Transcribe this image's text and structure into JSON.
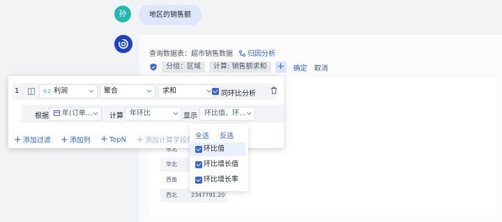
{
  "user_avatar": "孙",
  "user_message": "地区的销售额",
  "query": {
    "dataset_label": "查询数据表：超市销售数据",
    "attribution_link": "归因分析"
  },
  "chips": {
    "group": "分组：区域",
    "calc": "计算: 销售额求和",
    "confirm": "确定",
    "cancel": "取消"
  },
  "table_rows": [
    {
      "name": "东北",
      "value": ""
    },
    {
      "name": "华北",
      "value": ""
    },
    {
      "name": "西南",
      "value": ""
    },
    {
      "name": "西北",
      "value": "2347791.20"
    }
  ],
  "metric": {
    "index": "1",
    "field_tag": "0.2",
    "field": "利润",
    "mode": "聚合",
    "agg": "求和",
    "yoy_label": "同环比分析"
  },
  "basis": {
    "basis_label": "根据",
    "basis_value": "年(订单...",
    "calc_label": "计算",
    "calc_value": "年环比",
    "show_label": "显示",
    "show_value": "环比值、环..."
  },
  "actions": {
    "add_filter": "添加过滤",
    "add_column": "添加列",
    "topn": "TopN",
    "add_calc_field": "添加计算字段筛"
  },
  "dropdown": {
    "select_all": "全选",
    "invert": "反选",
    "options": [
      "环比值",
      "环比增长值",
      "环比增长率"
    ]
  },
  "colors": {
    "accent": "#3164e8",
    "user_avatar_bg": "#1fb9b0",
    "bot_avatar_bg": "#1c3fd1"
  }
}
